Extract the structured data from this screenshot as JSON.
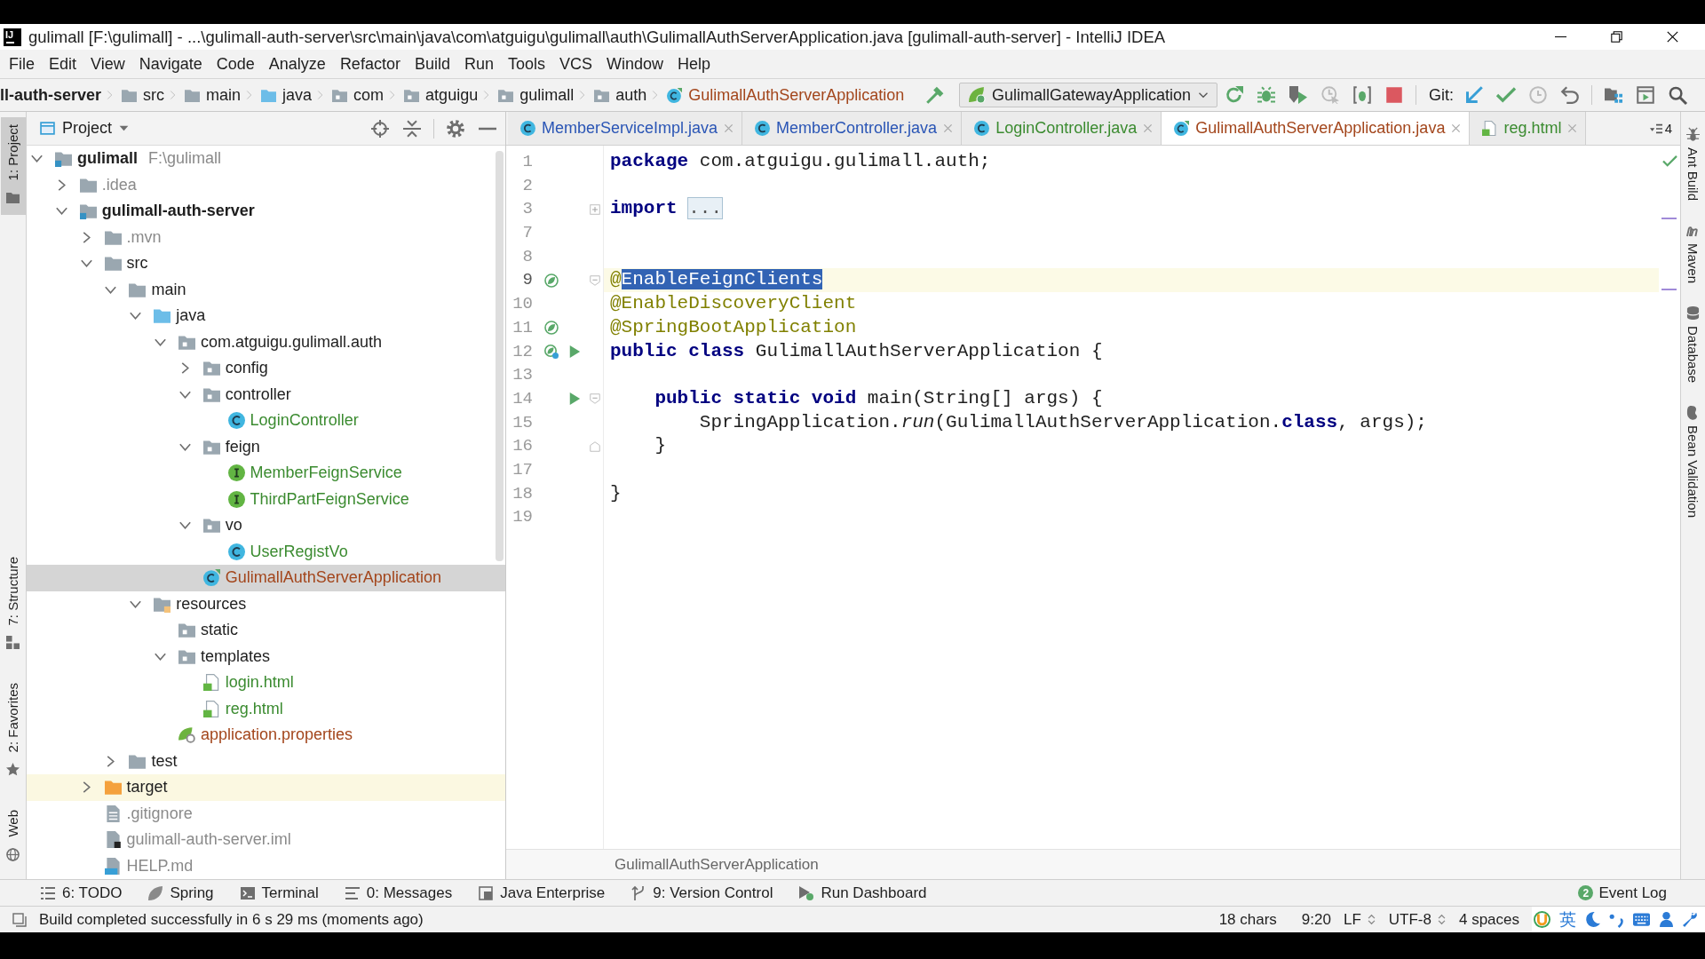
{
  "title_bar": {
    "logo": "IJ",
    "title": "gulimall [F:\\gulimall] - ...\\gulimall-auth-server\\src\\main\\java\\com\\atguigu\\gulimall\\auth\\GulimallAuthServerApplication.java [gulimall-auth-server] - IntelliJ IDEA"
  },
  "menu": [
    "File",
    "Edit",
    "View",
    "Navigate",
    "Code",
    "Analyze",
    "Refactor",
    "Build",
    "Run",
    "Tools",
    "VCS",
    "Window",
    "Help"
  ],
  "nav_bar": {
    "crumbs": [
      {
        "label": "ll-auth-server",
        "kind": "module"
      },
      {
        "label": "src",
        "kind": "folder"
      },
      {
        "label": "main",
        "kind": "folder"
      },
      {
        "label": "java",
        "kind": "source-folder"
      },
      {
        "label": "com",
        "kind": "package"
      },
      {
        "label": "atguigu",
        "kind": "package"
      },
      {
        "label": "gulimall",
        "kind": "package"
      },
      {
        "label": "auth",
        "kind": "package"
      },
      {
        "label": "GulimallAuthServerApplication",
        "kind": "spring-class",
        "color": "#a3461c"
      }
    ],
    "run_configuration": "GulimallGatewayApplication",
    "vcs_label": "Git:"
  },
  "left_strip": [
    {
      "label": "1: Project",
      "kind": "project",
      "selected": true
    },
    {
      "label": "7: Structure",
      "kind": "structure",
      "selected": false
    },
    {
      "label": "2: Favorites",
      "kind": "favorites",
      "selected": false
    },
    {
      "label": "Web",
      "kind": "web",
      "selected": false
    }
  ],
  "project_panel": {
    "title": "Project",
    "tree": [
      {
        "label": "gulimall",
        "path": "F:\\gulimall",
        "kind": "module",
        "expanded": true,
        "selected": false,
        "children": [
          {
            "label": ".idea",
            "kind": "folder",
            "expanded": false,
            "selected": false,
            "color": "#8a8a8a"
          },
          {
            "label": "gulimall-auth-server",
            "kind": "module",
            "expanded": true,
            "selected": false,
            "children": [
              {
                "label": ".mvn",
                "kind": "folder",
                "expanded": false,
                "selected": false,
                "color": "#8a8a8a"
              },
              {
                "label": "src",
                "kind": "folder",
                "expanded": true,
                "selected": false,
                "children": [
                  {
                    "label": "main",
                    "kind": "folder",
                    "expanded": true,
                    "selected": false,
                    "children": [
                      {
                        "label": "java",
                        "kind": "source-folder",
                        "expanded": true,
                        "selected": false,
                        "children": [
                          {
                            "label": "com.atguigu.gulimall.auth",
                            "kind": "package",
                            "expanded": true,
                            "selected": false,
                            "children": [
                              {
                                "label": "config",
                                "kind": "package",
                                "expanded": false,
                                "selected": false
                              },
                              {
                                "label": "controller",
                                "kind": "package",
                                "expanded": true,
                                "selected": false,
                                "children": [
                                  {
                                    "label": "LoginController",
                                    "kind": "class",
                                    "selected": false,
                                    "color": "#3b8b30"
                                  }
                                ]
                              },
                              {
                                "label": "feign",
                                "kind": "package",
                                "expanded": true,
                                "selected": false,
                                "children": [
                                  {
                                    "label": "MemberFeignService",
                                    "kind": "interface",
                                    "selected": false,
                                    "color": "#3b8b30"
                                  },
                                  {
                                    "label": "ThirdPartFeignService",
                                    "kind": "interface",
                                    "selected": false,
                                    "color": "#3b8b30"
                                  }
                                ]
                              },
                              {
                                "label": "vo",
                                "kind": "package",
                                "expanded": true,
                                "selected": false,
                                "children": [
                                  {
                                    "label": "UserRegistVo",
                                    "kind": "class",
                                    "selected": false,
                                    "color": "#3b8b30"
                                  }
                                ]
                              },
                              {
                                "label": "GulimallAuthServerApplication",
                                "kind": "spring-class",
                                "selected": true,
                                "color": "#a3461c"
                              }
                            ]
                          }
                        ]
                      },
                      {
                        "label": "resources",
                        "kind": "resources-folder",
                        "expanded": true,
                        "selected": false,
                        "children": [
                          {
                            "label": "static",
                            "kind": "package",
                            "selected": false
                          },
                          {
                            "label": "templates",
                            "kind": "package",
                            "expanded": true,
                            "selected": false,
                            "children": [
                              {
                                "label": "login.html",
                                "kind": "html",
                                "selected": false,
                                "color": "#3b8b30"
                              },
                              {
                                "label": "reg.html",
                                "kind": "html",
                                "selected": false,
                                "color": "#3b8b30"
                              }
                            ]
                          },
                          {
                            "label": "application.properties",
                            "kind": "properties",
                            "selected": false,
                            "color": "#a3461c"
                          }
                        ]
                      }
                    ]
                  },
                  {
                    "label": "test",
                    "kind": "folder",
                    "expanded": false,
                    "selected": false
                  }
                ]
              },
              {
                "label": "target",
                "kind": "excluded-folder",
                "expanded": false,
                "selected": false
              },
              {
                "label": ".gitignore",
                "kind": "text-file",
                "selected": false,
                "color": "#8a8a8a"
              },
              {
                "label": "gulimall-auth-server.iml",
                "kind": "module-file",
                "selected": false,
                "color": "#8a8a8a"
              },
              {
                "label": "HELP.md",
                "kind": "markdown-file",
                "selected": false,
                "color": "#8a8a8a"
              }
            ]
          }
        ]
      }
    ]
  },
  "editor": {
    "tabs": [
      {
        "label": "MemberServiceImpl.java",
        "kind": "class",
        "color": "#2a55b5",
        "selected": false
      },
      {
        "label": "MemberController.java",
        "kind": "class",
        "color": "#2a55b5",
        "selected": false
      },
      {
        "label": "LoginController.java",
        "kind": "class",
        "color": "#3b8b30",
        "selected": false
      },
      {
        "label": "GulimallAuthServerApplication.java",
        "kind": "spring-class",
        "color": "#a3461c",
        "selected": true
      },
      {
        "label": "reg.html",
        "kind": "html",
        "color": "#3b8b30",
        "selected": false
      }
    ],
    "overflow_count": "4",
    "lines": [
      {
        "number": "1",
        "current": false,
        "segments": [
          {
            "text": "package",
            "kind": "keyword"
          },
          {
            "text": " com.atguigu.gulimall.auth;",
            "kind": "plain"
          }
        ]
      },
      {
        "number": "2",
        "current": false
      },
      {
        "number": "3",
        "current": false,
        "fold_marker": {
          "kind": "collapsed"
        },
        "segments": [
          {
            "text": "import",
            "kind": "keyword"
          },
          {
            "text": "...",
            "kind": "folded"
          }
        ]
      },
      {
        "number": "7",
        "current": false
      },
      {
        "number": "8",
        "current": false
      },
      {
        "number": "9",
        "current": true,
        "fold_marker": {
          "kind": "start"
        },
        "gutter_icons": [
          {
            "kind": "bean"
          }
        ],
        "segments": [
          {
            "text": "@",
            "kind": "annotation"
          },
          {
            "text": "EnableFeignClients",
            "kind": "selection"
          }
        ]
      },
      {
        "number": "10",
        "current": false,
        "segments": [
          {
            "text": "@EnableDiscoveryClient",
            "kind": "annotation"
          }
        ]
      },
      {
        "number": "11",
        "current": false,
        "gutter_icons": [
          {
            "kind": "bean"
          }
        ],
        "segments": [
          {
            "text": "@SpringBootApplication",
            "kind": "annotation"
          }
        ]
      },
      {
        "number": "12",
        "current": false,
        "gutter_icons": [
          {
            "kind": "bean-boot"
          },
          {
            "kind": "run"
          }
        ],
        "segments": [
          {
            "text": "public class",
            "kind": "keyword"
          },
          {
            "text": " GulimallAuthServerApplication {",
            "kind": "plain"
          }
        ]
      },
      {
        "number": "13",
        "current": false
      },
      {
        "number": "14",
        "current": false,
        "fold_marker": {
          "kind": "start"
        },
        "gutter_icons": [
          {
            "kind": "run"
          }
        ],
        "segments": [
          {
            "text": "    public static void",
            "kind": "keyword"
          },
          {
            "text": " main(String[] args) {",
            "kind": "plain"
          }
        ]
      },
      {
        "number": "15",
        "current": false,
        "segments": [
          {
            "text": "        SpringApplication.",
            "kind": "plain"
          },
          {
            "text": "run",
            "kind": "italic"
          },
          {
            "text": "(GulimallAuthServerApplication.",
            "kind": "plain"
          },
          {
            "text": "class",
            "kind": "keyword"
          },
          {
            "text": ", args);",
            "kind": "plain"
          }
        ]
      },
      {
        "number": "16",
        "current": false,
        "fold_marker": {
          "kind": "end"
        },
        "segments": [
          {
            "text": "    }",
            "kind": "plain"
          }
        ]
      },
      {
        "number": "17",
        "current": false
      },
      {
        "number": "18",
        "current": false,
        "segments": [
          {
            "text": "}",
            "kind": "plain"
          }
        ]
      },
      {
        "number": "19",
        "current": false
      }
    ],
    "breadcrumb": "GulimallAuthServerApplication"
  },
  "right_strip": [
    {
      "label": "Ant Build",
      "kind": "ant"
    },
    {
      "label": "Maven",
      "kind": "maven"
    },
    {
      "label": "Database",
      "kind": "database"
    },
    {
      "label": "Bean Validation",
      "kind": "bean-validation"
    }
  ],
  "tool_bar": {
    "items": [
      {
        "label": "6: TODO",
        "kind": "todo"
      },
      {
        "label": "Spring",
        "kind": "spring"
      },
      {
        "label": "Terminal",
        "kind": "terminal"
      },
      {
        "label": "0: Messages",
        "kind": "messages"
      },
      {
        "label": "Java Enterprise",
        "kind": "java-enterprise"
      },
      {
        "label": "9: Version Control",
        "kind": "version-control"
      },
      {
        "label": "Run Dashboard",
        "kind": "run-dashboard"
      }
    ],
    "event_log": {
      "label": "Event Log",
      "count": "2"
    }
  },
  "status_bar": {
    "message": "Build completed successfully in 6 s 29 ms (moments ago)",
    "selection": "18 chars",
    "position": "9:20",
    "line_separator": "LF",
    "encoding": "UTF-8",
    "indent": "4 spaces",
    "input_mode": "英"
  }
}
